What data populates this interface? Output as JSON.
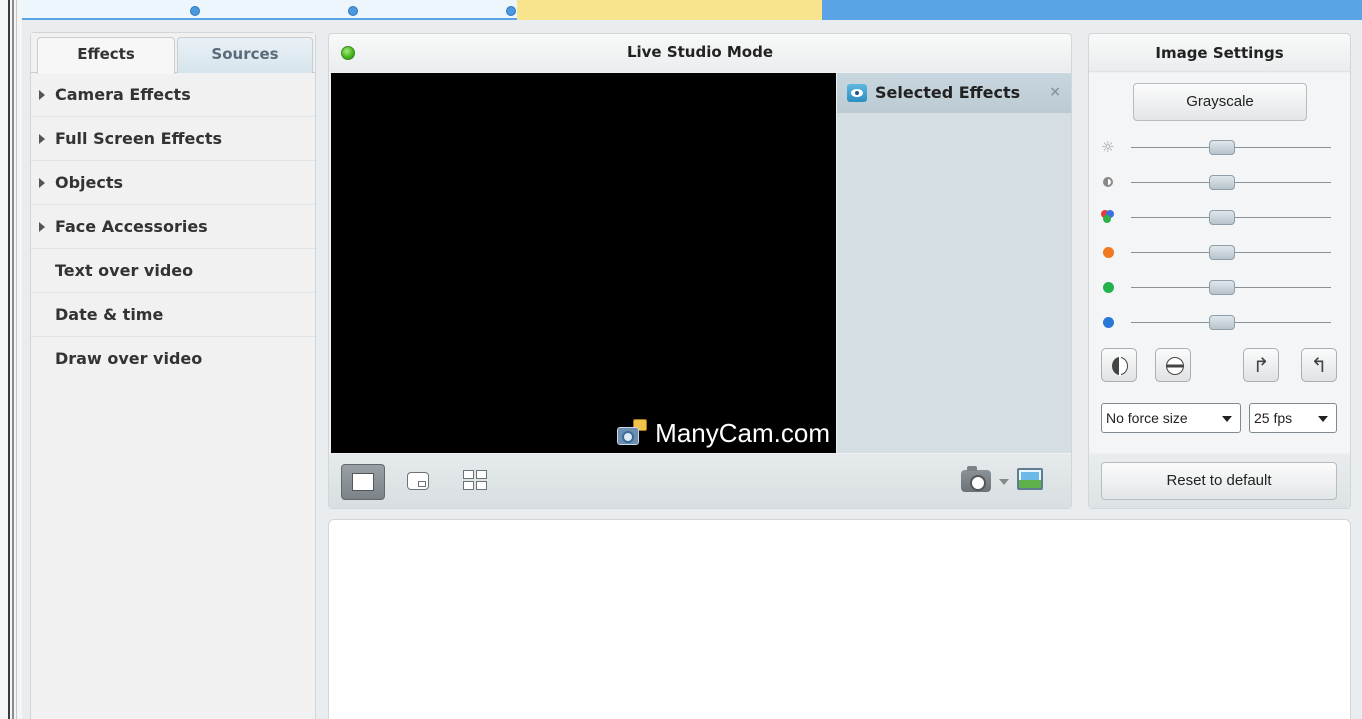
{
  "colors": {
    "accent_blue": "#5aa3e6",
    "timeline_yellow": "#f7e48c",
    "live_green": "#43b21d",
    "panel_bg": "#eef0f1",
    "video_bg": "#000000",
    "selected_effects_bg": "#d4dee3"
  },
  "left_panel": {
    "tabs": [
      {
        "label": "Effects",
        "active": true
      },
      {
        "label": "Sources",
        "active": false
      }
    ],
    "categories": [
      {
        "label": "Camera Effects",
        "expandable": true
      },
      {
        "label": "Full Screen Effects",
        "expandable": true
      },
      {
        "label": "Objects",
        "expandable": true
      },
      {
        "label": "Face Accessories",
        "expandable": true
      },
      {
        "label": "Text over video",
        "expandable": false
      },
      {
        "label": "Date & time",
        "expandable": false
      },
      {
        "label": "Draw over video",
        "expandable": false
      }
    ]
  },
  "studio": {
    "status_icon": "green-status-dot",
    "title": "Live Studio Mode",
    "watermark_text": "ManyCam.com",
    "selected_effects": {
      "title": "Selected Effects",
      "close_label": "×",
      "icon": "eye-icon"
    },
    "toolbar": {
      "layouts": [
        "single-view-icon",
        "picture-in-picture-icon",
        "grid-view-icon"
      ],
      "active_layout": "single-view-icon",
      "snapshot_icon": "camera-icon",
      "gallery_icon": "image-gallery-icon"
    }
  },
  "image_settings": {
    "title": "Image Settings",
    "grayscale_label": "Grayscale",
    "sliders": [
      {
        "name": "brightness",
        "icon": "sun-icon",
        "value": 0.5
      },
      {
        "name": "contrast",
        "icon": "contrast-icon",
        "value": 0.5
      },
      {
        "name": "saturation",
        "icon": "rgb-icon",
        "value": 0.5
      },
      {
        "name": "red",
        "icon": "red-dot-icon",
        "color": "#f07820",
        "value": 0.5
      },
      {
        "name": "green",
        "icon": "green-dot-icon",
        "color": "#22b14c",
        "value": 0.5
      },
      {
        "name": "blue",
        "icon": "blue-dot-icon",
        "color": "#2878d8",
        "value": 0.5
      }
    ],
    "transform_icons": [
      "mirror-icon",
      "flip-icon",
      "rotate-right-icon",
      "rotate-left-icon"
    ],
    "size_select": {
      "value": "No force size"
    },
    "fps_select": {
      "value": "25 fps"
    },
    "reset_label": "Reset to default"
  }
}
